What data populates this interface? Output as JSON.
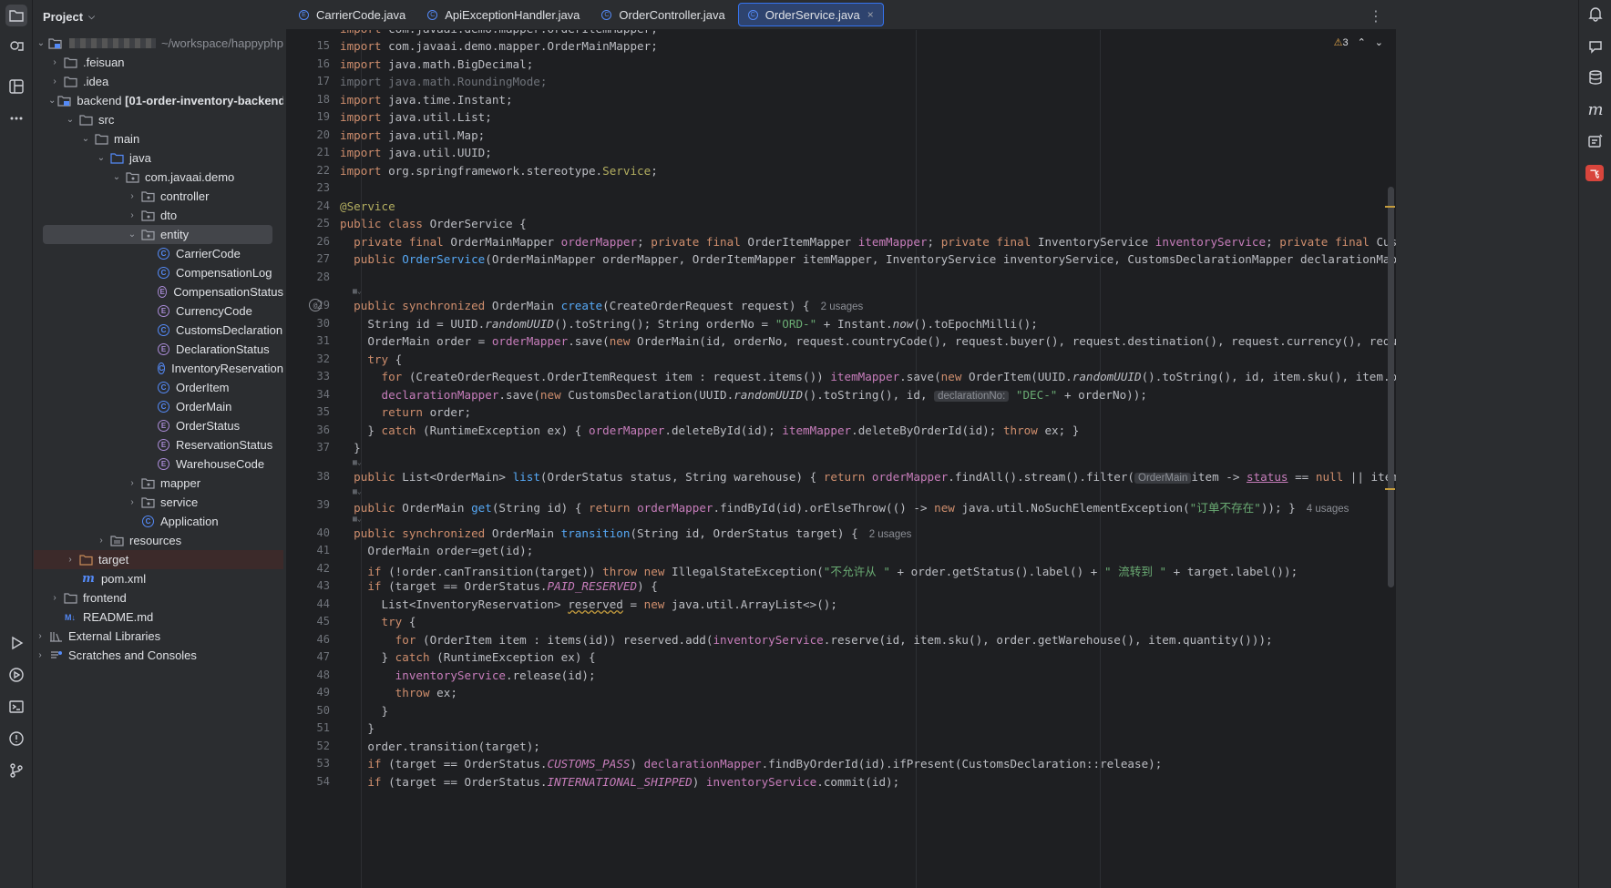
{
  "project_panel": {
    "title": "Project",
    "root_path": "~/workspace/happyphp",
    "items": [
      {
        "label": ".feisuan",
        "type": "folder"
      },
      {
        "label": ".idea",
        "type": "folder"
      },
      {
        "label": "backend",
        "suffix": "[01-order-inventory-backend]",
        "type": "module"
      },
      {
        "label": "src",
        "type": "folder"
      },
      {
        "label": "main",
        "type": "folder"
      },
      {
        "label": "java",
        "type": "source"
      },
      {
        "label": "com.javaai.demo",
        "type": "package"
      },
      {
        "label": "controller",
        "type": "package"
      },
      {
        "label": "dto",
        "type": "package"
      },
      {
        "label": "entity",
        "type": "package"
      },
      {
        "label": "CarrierCode",
        "type": "class"
      },
      {
        "label": "CompensationLog",
        "type": "class"
      },
      {
        "label": "CompensationStatus",
        "type": "enum"
      },
      {
        "label": "CurrencyCode",
        "type": "enum"
      },
      {
        "label": "CustomsDeclaration",
        "type": "class"
      },
      {
        "label": "DeclarationStatus",
        "type": "enum"
      },
      {
        "label": "InventoryReservation",
        "type": "class"
      },
      {
        "label": "OrderItem",
        "type": "class"
      },
      {
        "label": "OrderMain",
        "type": "class"
      },
      {
        "label": "OrderStatus",
        "type": "enum"
      },
      {
        "label": "ReservationStatus",
        "type": "enum"
      },
      {
        "label": "WarehouseCode",
        "type": "enum"
      },
      {
        "label": "mapper",
        "type": "package"
      },
      {
        "label": "service",
        "type": "package"
      },
      {
        "label": "Application",
        "type": "class"
      },
      {
        "label": "resources",
        "type": "folder"
      },
      {
        "label": "target",
        "type": "folder"
      },
      {
        "label": "pom.xml",
        "type": "maven"
      },
      {
        "label": "frontend",
        "type": "folder"
      },
      {
        "label": "README.md",
        "type": "markdown"
      },
      {
        "label": "External Libraries",
        "type": "libraries"
      },
      {
        "label": "Scratches and Consoles",
        "type": "scratches"
      }
    ]
  },
  "tabs": [
    {
      "label": "CarrierCode.java"
    },
    {
      "label": "ApiExceptionHandler.java"
    },
    {
      "label": "OrderController.java"
    },
    {
      "label": "OrderService.java",
      "active": true
    }
  ],
  "editor": {
    "warnings_count": "3",
    "line_numbers": [
      "15",
      "16",
      "17",
      "18",
      "19",
      "20",
      "21",
      "22",
      "23",
      "24",
      "25",
      "26",
      "27",
      "28",
      "29",
      "30",
      "31",
      "32",
      "33",
      "34",
      "35",
      "36",
      "37",
      "38",
      "39",
      "40",
      "41",
      "42",
      "43",
      "44",
      "45",
      "46",
      "47",
      "48",
      "49",
      "50",
      "51",
      "52",
      "53",
      "54"
    ],
    "hints": {
      "create_usages": "2 usages",
      "get_usages": "4 usages",
      "transition_usages": "2 usages",
      "declaration_hint": "declarationNo:",
      "ordermain_hint": "OrderMain"
    }
  },
  "icons": {
    "left_bar": [
      "folder-icon",
      "commit-icon",
      "structure-icon",
      "more-icon",
      "run-icon",
      "services-icon",
      "terminal-icon",
      "problems-icon",
      "git-icon"
    ],
    "right_bar": [
      "notifications-icon",
      "ai-chat-icon",
      "database-icon",
      "maven-icon",
      "ai-assistant-icon",
      "plugin-icon"
    ]
  }
}
